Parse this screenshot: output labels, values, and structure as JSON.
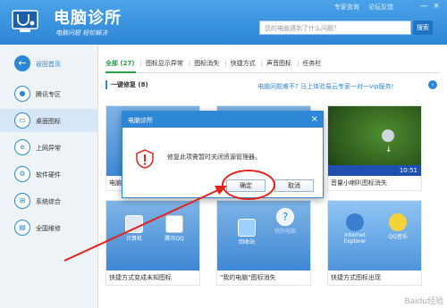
{
  "app": {
    "title": "电脑诊所",
    "slogan": "电脑问题 轻松解决",
    "top_links": [
      "专家咨询",
      "论坛反馈"
    ],
    "window_controls": [
      "—",
      "×"
    ]
  },
  "search": {
    "placeholder": "您的电脑遇到了什么问题？",
    "button": "搜索"
  },
  "sidebar": {
    "back_label": "返回首页",
    "items": [
      {
        "label": "腾讯专区",
        "icon": "penguin-icon"
      },
      {
        "label": "桌面图标",
        "icon": "desktop-icon",
        "active": true
      },
      {
        "label": "上网异常",
        "icon": "ie-icon"
      },
      {
        "label": "软件硬件",
        "icon": "gear-icon"
      },
      {
        "label": "系统综合",
        "icon": "system-icon"
      },
      {
        "label": "全国维修",
        "icon": "repair-icon"
      }
    ]
  },
  "tabs": [
    {
      "label": "全部 (27)",
      "active": true
    },
    {
      "label": "图标显示异常"
    },
    {
      "label": "图标消失"
    },
    {
      "label": "快捷方式"
    },
    {
      "label": "声音图标"
    },
    {
      "label": "任务栏"
    }
  ],
  "subbar": {
    "fix_label": "一键修复 (8)",
    "promo": "电脑问题难不? 马上体验易云专家一对一vip服务!"
  },
  "cards": [
    {
      "caption": "电脑",
      "bg": "blue"
    },
    {
      "caption": "",
      "bg": "blue"
    },
    {
      "caption": "音量小喇叭图标消失",
      "bg": "green",
      "tray_time": "10:51"
    },
    {
      "caption": "快捷方式变成未知图标",
      "bg": "blue",
      "icons": [
        "计算机",
        "腾讯QQ"
      ]
    },
    {
      "caption": "\"我的电脑\"图标消失",
      "bg": "blue",
      "icons": [
        "回收站",
        "我的电脑"
      ]
    },
    {
      "caption": "快捷方式图标出现",
      "bg": "xp",
      "icons": [
        "Internet Explorer",
        "QQ音乐"
      ]
    }
  ],
  "dialog": {
    "title": "电脑诊所",
    "message": "修复此项需暂时关闭资源管理器。",
    "ok": "确定",
    "cancel": "取消"
  },
  "colors": {
    "brand": "#2e86d6",
    "tab_active": "#2aa14a",
    "annotation": "#e2231a"
  },
  "watermark": "Baidu经验"
}
